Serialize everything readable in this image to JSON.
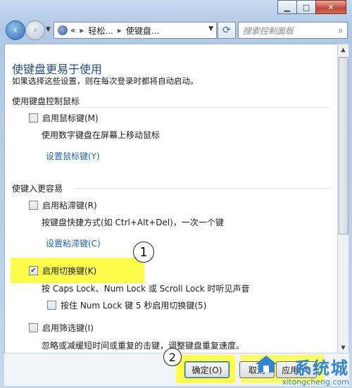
{
  "window": {
    "minimize_glyph": "▁",
    "maximize_glyph": "□",
    "close_glyph": "✕"
  },
  "nav": {
    "address_parts": [
      "«",
      "轻松...",
      "使键盘..."
    ],
    "search_placeholder": "搜索控制面板"
  },
  "page": {
    "title": "使键盘更易于使用",
    "description": "如果选择这些设置，则在每次登录时都将自动启动。",
    "sections": [
      {
        "heading": "使用键盘控制鼠标",
        "checkbox_label": "启用鼠标键(M)",
        "checked": false,
        "sub_text": "使用数字键盘在屏幕上移动鼠标",
        "link": "设置鼠标键(Y)"
      },
      {
        "heading": "使键入更容易",
        "sticky": {
          "checkbox_label": "启用粘滞键(R)",
          "checked": false,
          "sub_text": "按键盘快捷方式(如 Ctrl+Alt+Del)，一次一个键",
          "link": "设置粘滞键(C)"
        },
        "toggle": {
          "checkbox_label": "启用切换键(K)",
          "checked": true,
          "sub_text": "按 Caps Lock、Num Lock 或 Scroll Lock 时听见声音",
          "nested_checkbox_label": "按住 Num Lock 键 5 秒启用切换键(5)",
          "nested_checked": false
        },
        "filter": {
          "checkbox_label": "启用筛选键(I)",
          "checked": false,
          "sub_text": "忽略或减缓短时间或重复的击键，调整键盘重复速度。"
        }
      }
    ]
  },
  "markers": [
    "1",
    "2"
  ],
  "buttons": {
    "ok": "确定(O)",
    "cancel": "取消",
    "apply": "应用(A)"
  },
  "watermark": {
    "brand": "系统城",
    "url": "xitongcheng.com"
  },
  "colors": {
    "highlight": "#fdfc48",
    "link": "#1a66b4",
    "title": "#1f4e8c",
    "watermark": "#2e86d9"
  }
}
